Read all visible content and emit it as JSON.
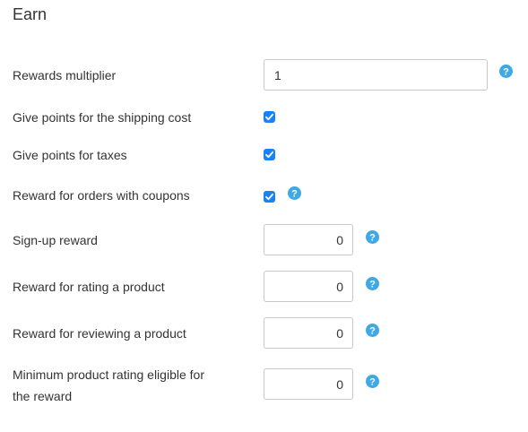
{
  "section": {
    "title": "Earn"
  },
  "fields": {
    "rewards_multiplier": {
      "label": "Rewards multiplier",
      "value": "1"
    },
    "shipping_points": {
      "label": "Give points for the shipping cost",
      "checked": true
    },
    "tax_points": {
      "label": "Give points for taxes",
      "checked": true
    },
    "coupon_orders": {
      "label": "Reward for orders with coupons",
      "checked": true
    },
    "signup_reward": {
      "label": "Sign-up reward",
      "value": "0"
    },
    "rating_reward": {
      "label": "Reward for rating a product",
      "value": "0"
    },
    "review_reward": {
      "label": "Reward for reviewing a product",
      "value": "0"
    },
    "min_rating": {
      "label_line1": "Minimum product rating eligible for",
      "label_line2": "the reward",
      "value": "0"
    }
  },
  "icons": {
    "help": "help-circle-icon",
    "checkbox_check": "checkmark-icon"
  },
  "colors": {
    "accent": "#1a82f7",
    "help_icon": "#3fa9e6"
  }
}
